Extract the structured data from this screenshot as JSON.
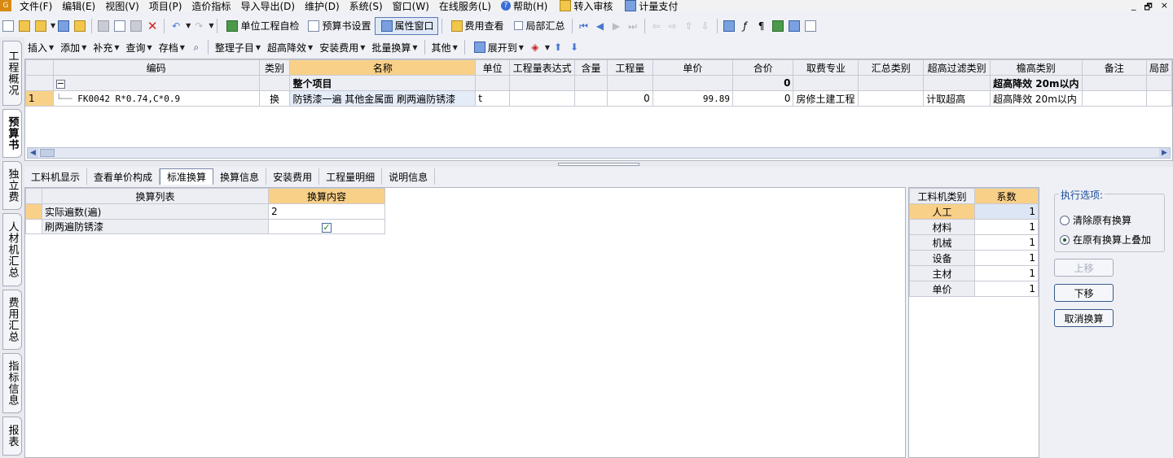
{
  "menu": [
    "文件(F)",
    "编辑(E)",
    "视图(V)",
    "项目(P)",
    "造价指标",
    "导入导出(D)",
    "维护(D)",
    "系统(S)",
    "窗口(W)",
    "在线服务(L)",
    "帮助(H)",
    "转入审核",
    "计量支付"
  ],
  "toolbar1": {
    "self_check": "单位工程自检",
    "budget_settings": "预算书设置",
    "property_window": "属性窗口",
    "fee_view": "费用查看",
    "partial_summary": "局部汇总"
  },
  "toolbar2": {
    "insert": "插入",
    "add": "添加",
    "supplement": "补充",
    "query": "查询",
    "save": "存档",
    "organize": "整理子目",
    "high_reduce": "超高降效",
    "install_fee": "安装费用",
    "batch_convert": "批量换算",
    "other": "其他",
    "expand_to": "展开到"
  },
  "vtabs": [
    "工程概况",
    "预算书",
    "独立费",
    "人材机汇总",
    "费用汇总",
    "指标信息",
    "报表"
  ],
  "grid": {
    "columns": [
      "编码",
      "类别",
      "名称",
      "单位",
      "工程量表达式",
      "含量",
      "工程量",
      "单价",
      "合价",
      "取费专业",
      "汇总类别",
      "超高过滤类别",
      "檐高类别",
      "备注",
      "局部"
    ],
    "summary_row": {
      "toggle": "−",
      "name": "整个项目",
      "total": "0",
      "eave": "超高降效 20m以内"
    },
    "rows": [
      {
        "no": "1",
        "code": "FK0042 R*0.74,C*0.9",
        "type": "换",
        "name": "防锈漆一遍 其他金属面 刷两遍防锈漆",
        "unit": "t",
        "expr": "",
        "content": "",
        "qty": "0",
        "price": "99.89",
        "total": "0",
        "fee_major": "房修土建工程",
        "sum_type": "",
        "filter": "计取超高",
        "eave": "超高降效 20m以内",
        "remark": ""
      }
    ]
  },
  "bottom_tabs": [
    "工料机显示",
    "查看单价构成",
    "标准换算",
    "换算信息",
    "安装费用",
    "工程量明细",
    "说明信息"
  ],
  "conversion": {
    "header_list": "换算列表",
    "header_content": "换算内容",
    "rows": [
      {
        "label": "实际遍数(遍)",
        "value": "2"
      },
      {
        "label": "刷两遍防锈漆",
        "value": "✓"
      }
    ]
  },
  "coefficients": {
    "header_type": "工料机类别",
    "header_coef": "系数",
    "rows": [
      {
        "type": "人工",
        "coef": "1"
      },
      {
        "type": "材料",
        "coef": "1"
      },
      {
        "type": "机械",
        "coef": "1"
      },
      {
        "type": "设备",
        "coef": "1"
      },
      {
        "type": "主材",
        "coef": "1"
      },
      {
        "type": "单价",
        "coef": "1"
      }
    ]
  },
  "options": {
    "legend": "执行选项:",
    "clear": "清除原有换算",
    "overlay": "在原有换算上叠加",
    "up": "上移",
    "down": "下移",
    "cancel": "取消换算"
  },
  "win": {
    "min": "_",
    "restore": "🗗",
    "close": "×"
  }
}
